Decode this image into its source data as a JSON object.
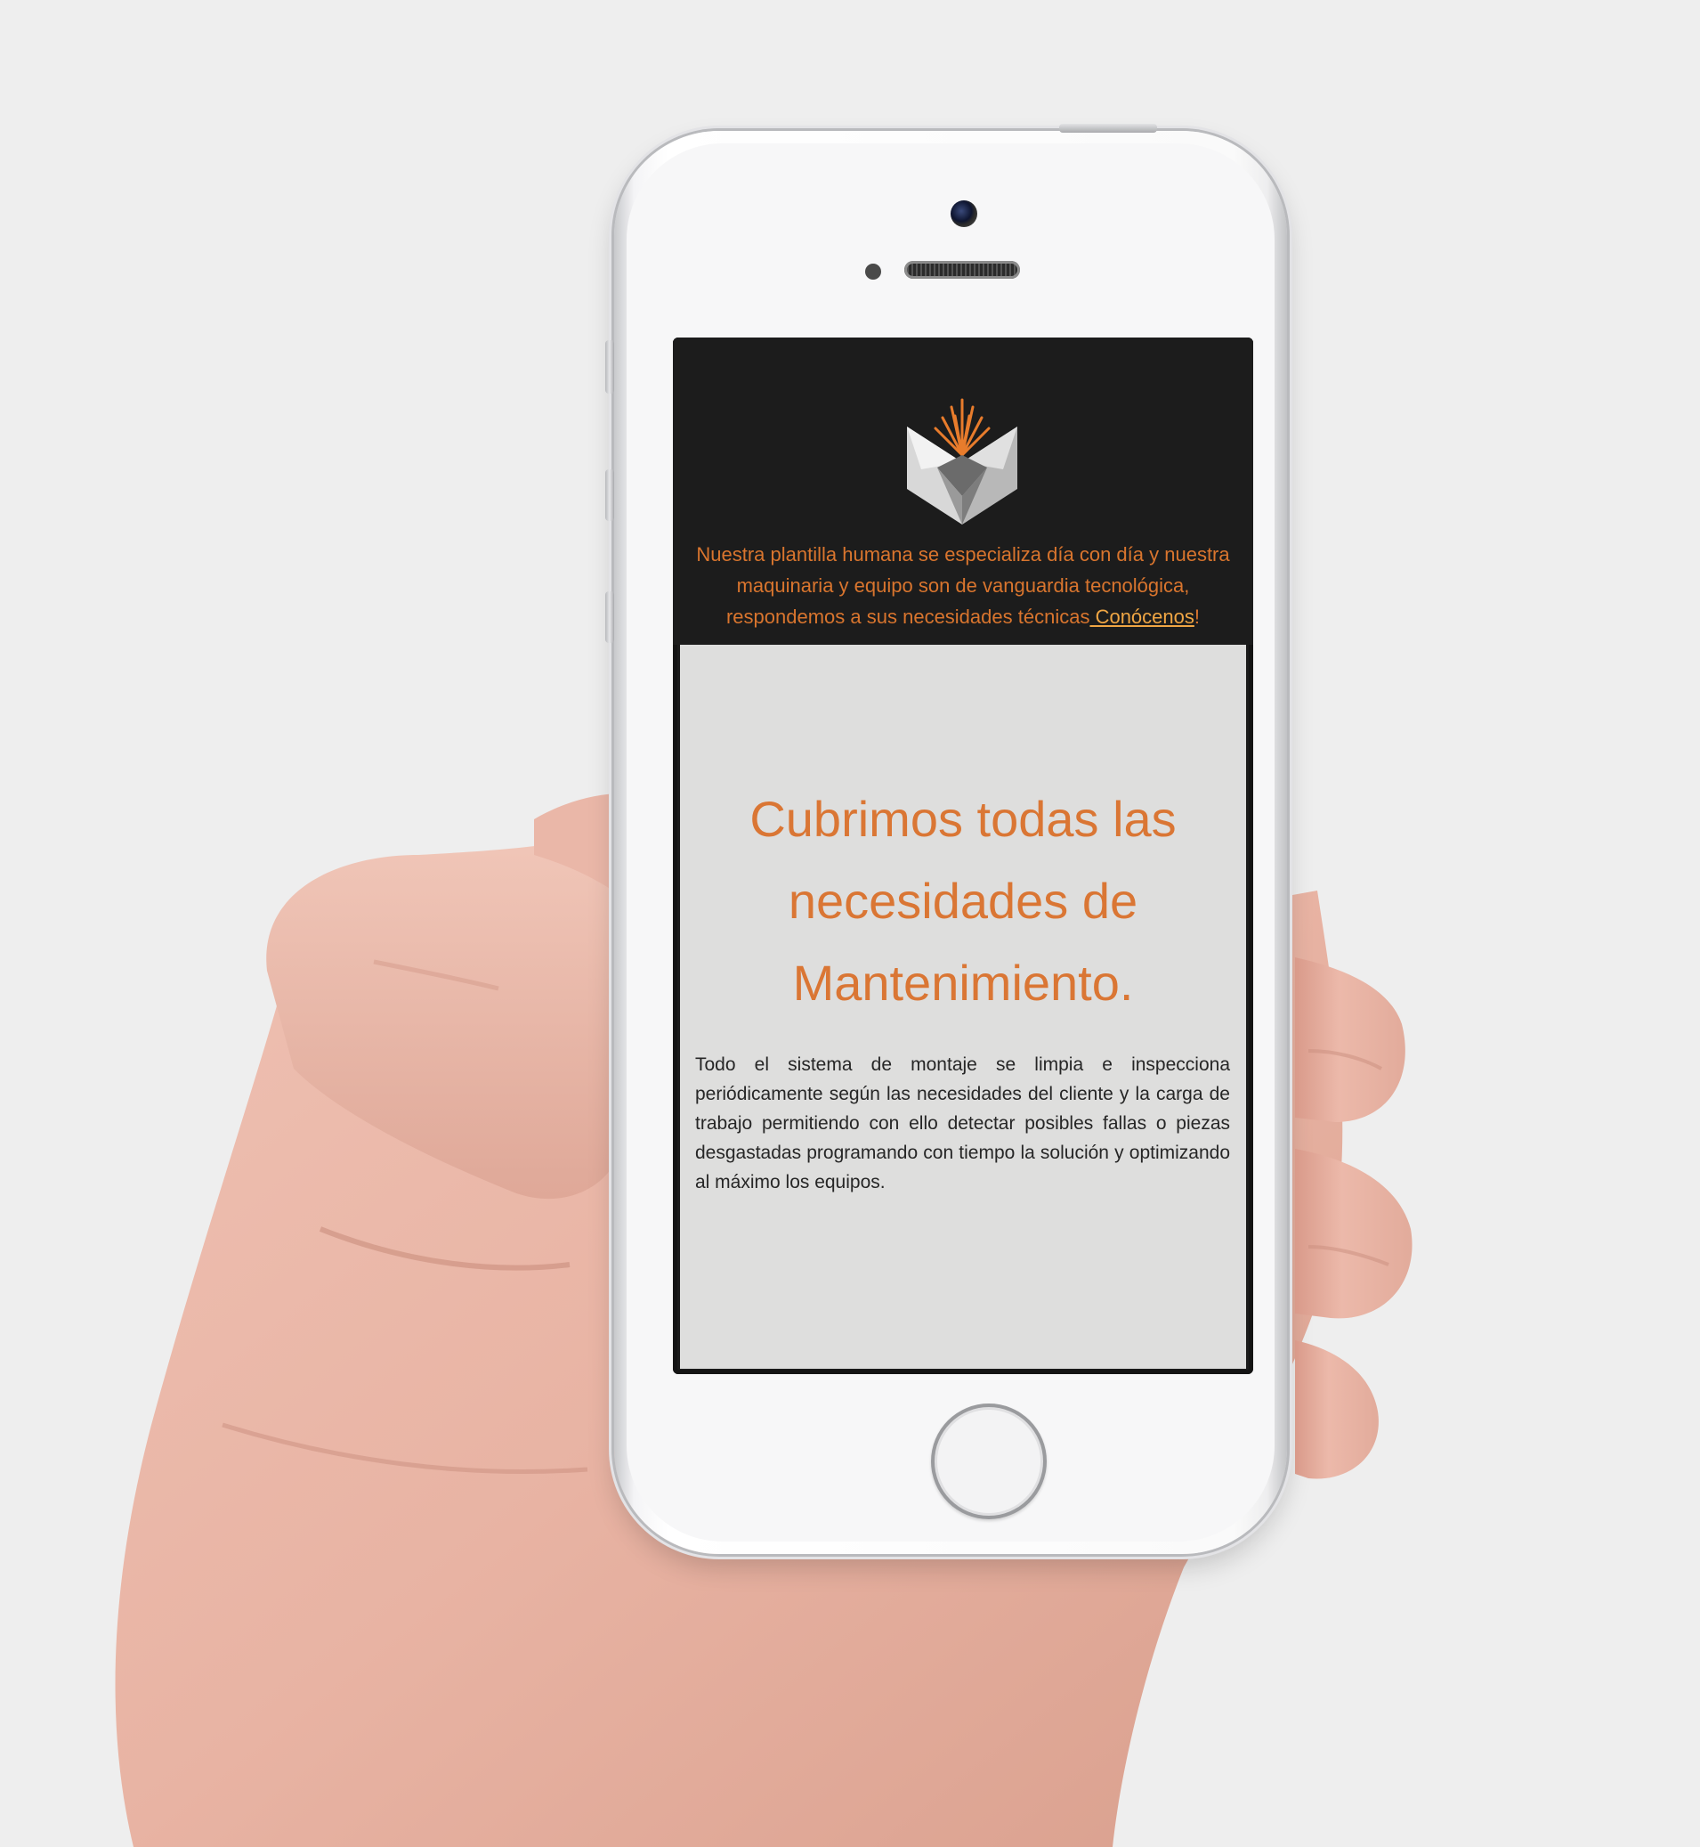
{
  "header": {
    "intro_text": "Nuestra plantilla humana se especializa día con día y nuestra maquinaria y equipo son de vanguardia tecnológica, respondemos a sus necesidades técnicas",
    "intro_link": " Conócenos",
    "intro_end": "!"
  },
  "main": {
    "headline": "Cubrimos todas las necesidades de Mantenimiento.",
    "body": "Todo el sistema de montaje se limpia e inspecciona periódicamente según las necesidades del cliente y la carga de trabajo permitiendo con ello detectar posibles fallas o piezas desgastadas programando con tiempo la solución y optimizando al máximo los equipos."
  },
  "colors": {
    "background": "#eeeeee",
    "header_bg": "#1c1c1c",
    "content_bg": "#dededd",
    "accent_orange": "#da7634",
    "link_color": "#f0a644",
    "body_text": "#262626"
  },
  "icons": {
    "logo": "company-logo-icon"
  }
}
